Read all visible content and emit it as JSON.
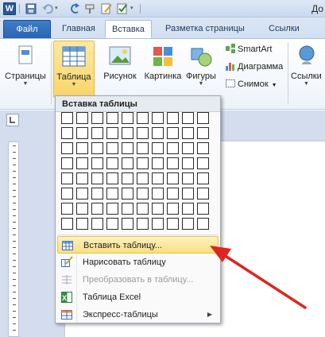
{
  "window": {
    "title_fragment": "До",
    "app_logo_letter": "W"
  },
  "tabs": [
    {
      "label": "Файл",
      "active": false
    },
    {
      "label": "Главная",
      "active": false
    },
    {
      "label": "Вставка",
      "active": true
    },
    {
      "label": "Разметка страницы",
      "active": false
    },
    {
      "label": "Ссылки",
      "active": false
    }
  ],
  "ribbon": {
    "pages": "Страницы",
    "table": "Таблица",
    "picture": "Рисунок",
    "clipart": "Картинка",
    "shapes": "Фигуры",
    "smartart": "SmartArt",
    "chart": "Диаграмма",
    "screenshot": "Снимок",
    "links": "Ссылки"
  },
  "dropdown": {
    "header": "Вставка таблицы",
    "grid": {
      "columns": 10,
      "rows": 8
    },
    "items": [
      {
        "label": "Вставить таблицу...",
        "icon": "insert-table-icon",
        "highlighted": true,
        "disabled": false
      },
      {
        "label": "Нарисовать таблицу",
        "icon": "draw-table-icon",
        "highlighted": false,
        "disabled": false
      },
      {
        "label": "Преобразовать в таблицу...",
        "icon": "convert-table-icon",
        "highlighted": false,
        "disabled": true
      },
      {
        "label": "Таблица Excel",
        "icon": "excel-icon",
        "highlighted": false,
        "disabled": false
      },
      {
        "label": "Экспресс-таблицы",
        "icon": "quick-tables-icon",
        "highlighted": false,
        "disabled": false,
        "submenu": true
      }
    ]
  },
  "colors": {
    "accent_file_tab": "#2a63b3",
    "highlight": "#fbdf7e",
    "annotation_arrow": "#e0241f"
  }
}
